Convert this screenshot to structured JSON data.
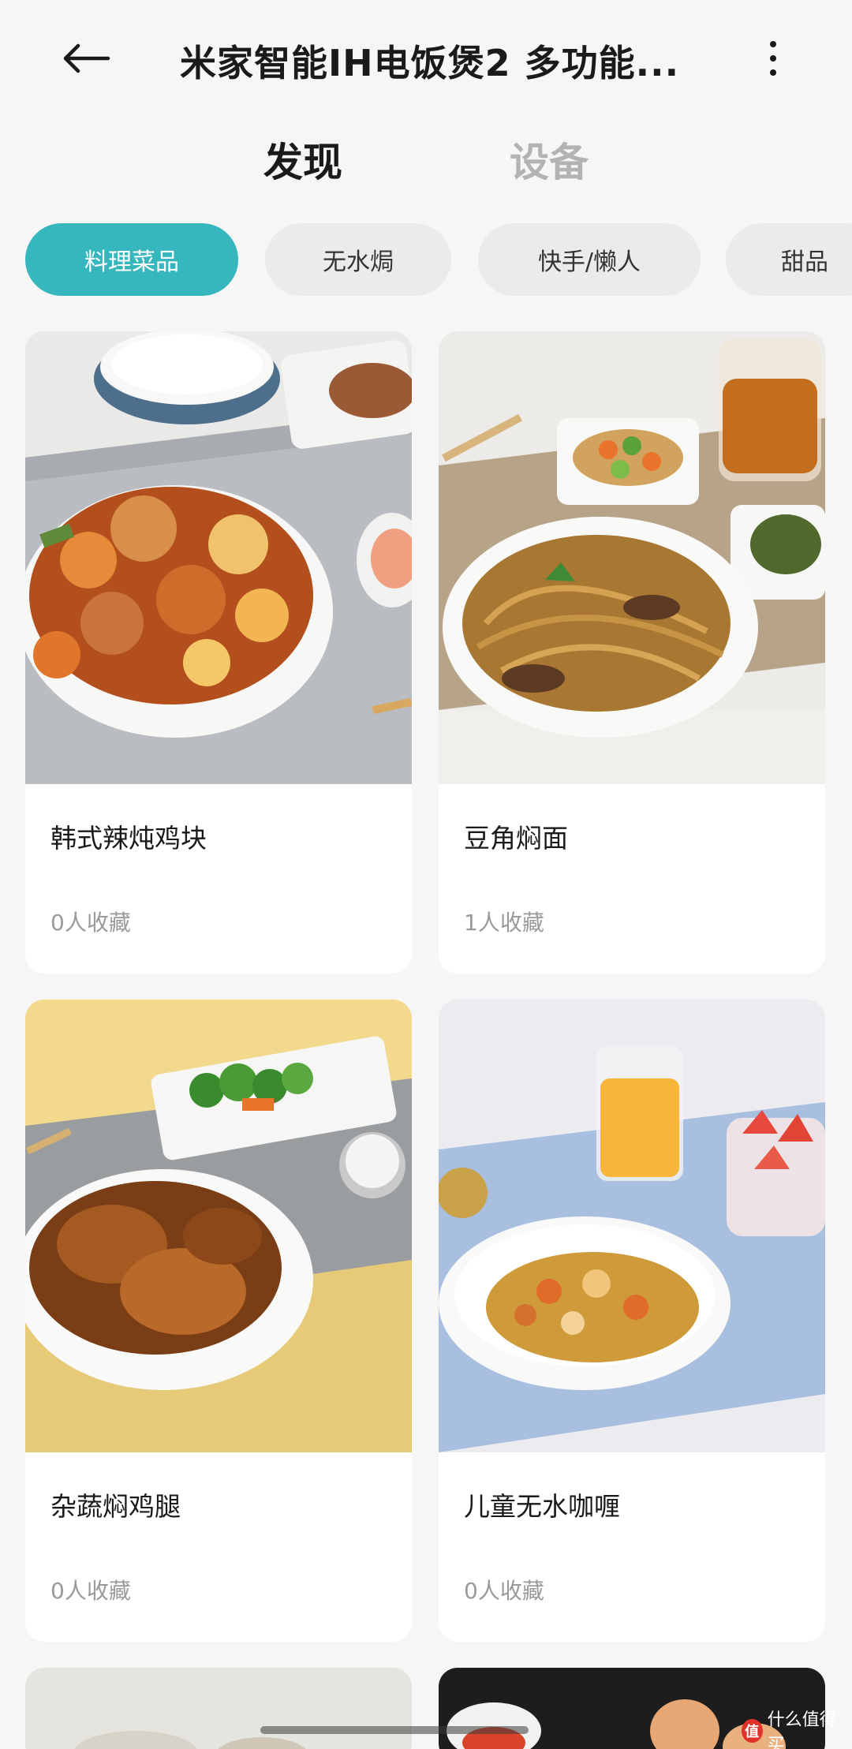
{
  "header": {
    "title": "米家智能IH电饭煲2 多功能...",
    "back_icon": "arrow-left-icon",
    "more_icon": "more-vertical-icon"
  },
  "top_tabs": [
    {
      "label": "发现",
      "active": true
    },
    {
      "label": "设备",
      "active": false
    }
  ],
  "chips": [
    {
      "label": "料理菜品",
      "active": true
    },
    {
      "label": "无水焗",
      "active": false
    },
    {
      "label": "快手/懒人",
      "active": false
    },
    {
      "label": "甜品",
      "active": false
    }
  ],
  "recipes": [
    {
      "title": "韩式辣炖鸡块",
      "favorites": "0人收藏"
    },
    {
      "title": "豆角焖面",
      "favorites": "1人收藏"
    },
    {
      "title": "杂蔬焖鸡腿",
      "favorites": "0人收藏"
    },
    {
      "title": "儿童无水咖喱",
      "favorites": "0人收藏"
    }
  ],
  "watermark": {
    "text": "什么值得买",
    "mark": "值"
  },
  "colors": {
    "accent": "#36b6bd",
    "page_bg": "#f6f6f6"
  }
}
